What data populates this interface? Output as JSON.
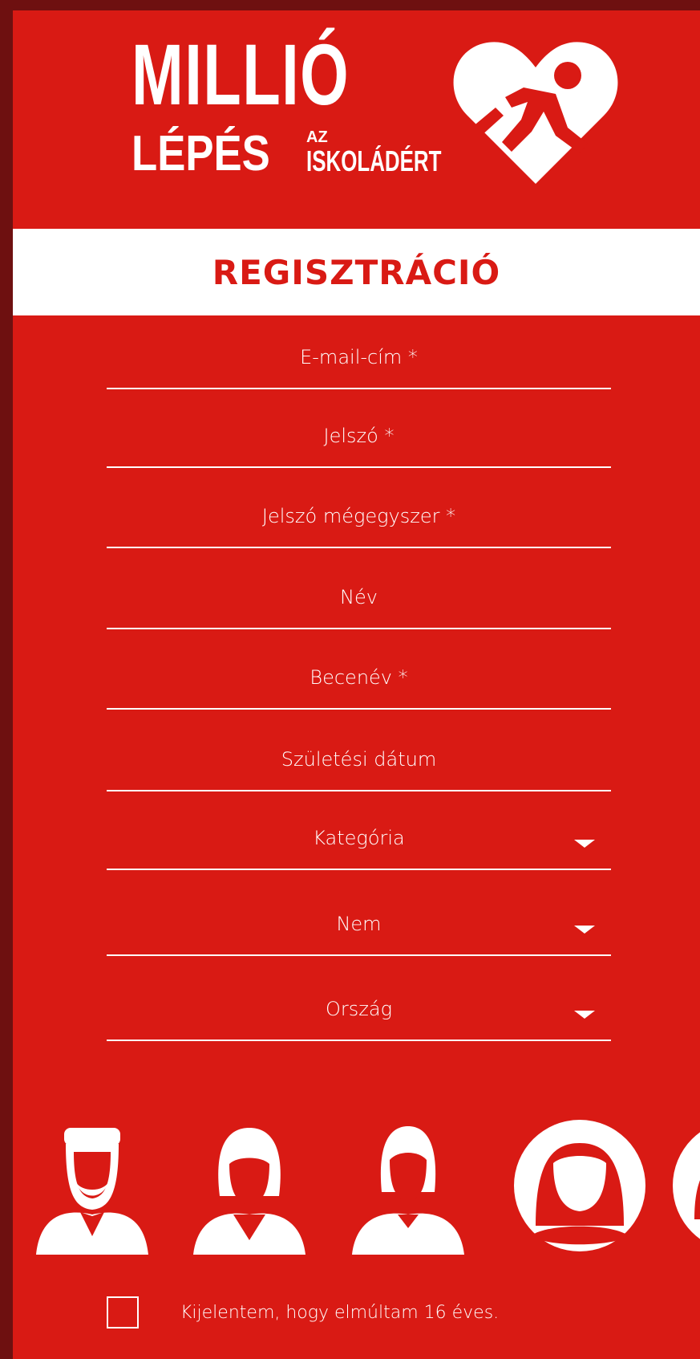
{
  "logo": {
    "line1": "MILLIÓ",
    "line2": "LÉPÉS",
    "az": "AZ",
    "iskola": "ISKOLÁDÉRT"
  },
  "title": "REGISZTRÁCIÓ",
  "fields": {
    "email": "E-mail-cím *",
    "password": "Jelszó *",
    "password_again": "Jelszó mégegyszer *",
    "name": "Név",
    "nickname": "Becenév *",
    "birthdate": "Születési dátum",
    "category": "Kategória",
    "gender": "Nem",
    "country": "Ország"
  },
  "avatars": [
    "avatar-man-beard",
    "avatar-woman-bob",
    "avatar-woman",
    "avatar-woman-circle-selected",
    "avatar-partial"
  ],
  "consent": {
    "label": "Kijelentem, hogy elmúltam 16 éves.",
    "checked": false
  },
  "colors": {
    "background": "#d91a14",
    "accent": "#ffffff",
    "frame": "#6e1010"
  }
}
